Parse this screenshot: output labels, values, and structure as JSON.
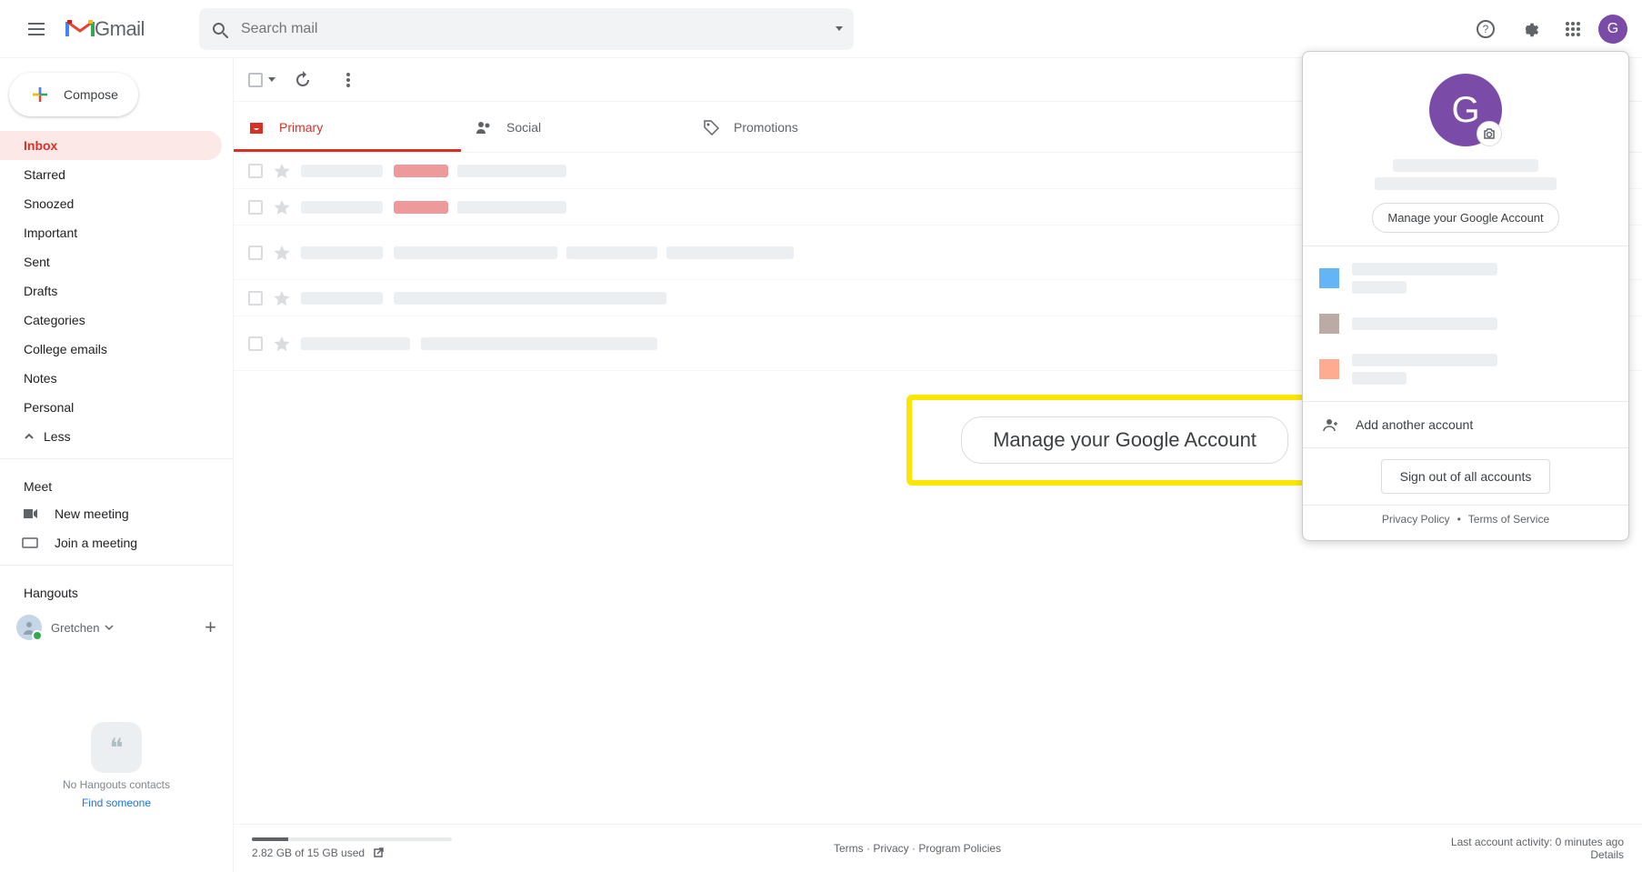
{
  "header": {
    "logo_text": "Gmail",
    "search_placeholder": "Search mail",
    "avatar_initial": "G"
  },
  "sidebar": {
    "compose": "Compose",
    "nav": [
      {
        "label": "Inbox",
        "active": true
      },
      {
        "label": "Starred"
      },
      {
        "label": "Snoozed"
      },
      {
        "label": "Important"
      },
      {
        "label": "Sent"
      },
      {
        "label": "Drafts"
      },
      {
        "label": "Categories"
      },
      {
        "label": "College emails"
      },
      {
        "label": "Notes"
      },
      {
        "label": "Personal"
      }
    ],
    "less": "Less",
    "meet_title": "Meet",
    "meet_new": "New meeting",
    "meet_join": "Join a meeting",
    "hangouts_title": "Hangouts",
    "hangouts_user": "Gretchen",
    "hangouts_empty": "No Hangouts contacts",
    "hangouts_find": "Find someone"
  },
  "tabs": {
    "primary": "Primary",
    "social": "Social",
    "promotions": "Promotions"
  },
  "callout": {
    "label": "Manage your Google Account"
  },
  "account_panel": {
    "avatar_initial": "G",
    "manage": "Manage your Google Account",
    "add": "Add another account",
    "signout": "Sign out of all accounts",
    "privacy": "Privacy Policy",
    "sep": "•",
    "tos": "Terms of Service"
  },
  "footer": {
    "storage_used": "2.82 GB of 15 GB used",
    "links": "Terms · Privacy · Program Policies",
    "activity": "Last account activity: 0 minutes ago",
    "details": "Details"
  }
}
